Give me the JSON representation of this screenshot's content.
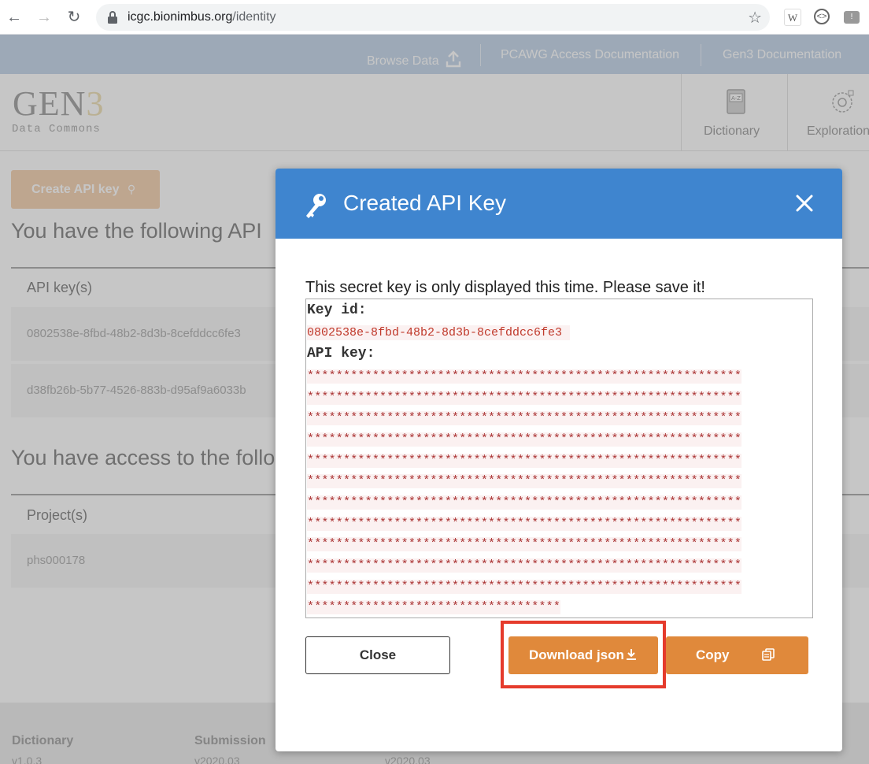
{
  "browser": {
    "url_host": "icgc.bionimbus.org",
    "url_path": "/identity",
    "ext1": "W"
  },
  "topnav": {
    "links": [
      "Browse Data",
      "PCAWG Access Documentation",
      "Gen3 Documentation"
    ]
  },
  "header": {
    "logo_text": "GEN",
    "logo_num": "3",
    "logo_sub": "Data Commons",
    "tabs": [
      "Dictionary",
      "Exploration"
    ]
  },
  "page": {
    "create_button": "Create API key",
    "heading_keys": "You have the following API",
    "keys_column": "API key(s)",
    "keys": [
      "0802538e-8fbd-48b2-8d3b-8cefddcc6fe3",
      "d38fb26b-5b77-4526-883b-d95af9a6033b"
    ],
    "heading_projects": "You have access to the follo",
    "projects_column": "Project(s)",
    "projects": [
      "phs000178"
    ]
  },
  "footer": {
    "items": [
      {
        "label": "Dictionary",
        "version": "v1.0.3"
      },
      {
        "label": "Submission",
        "version": "v2020.03"
      },
      {
        "label": "",
        "version": "v2020.03"
      }
    ]
  },
  "modal": {
    "title": "Created API Key",
    "message": "This secret key is only displayed this time. Please save it!",
    "key_id_label": "Key id:",
    "key_id": "0802538e-8fbd-48b2-8d3b-8cefddcc6fe3",
    "api_key_label": "API key:",
    "api_key_full_line": "************************************************************",
    "api_key_last_line": "***********************************",
    "close_button": "Close",
    "download_button": "Download json",
    "copy_button": "Copy"
  },
  "colors": {
    "topbar": "#b9cee6",
    "modal_header": "#3f85cf",
    "action_button": "#e0893b",
    "highlight": "#e53b2c"
  }
}
